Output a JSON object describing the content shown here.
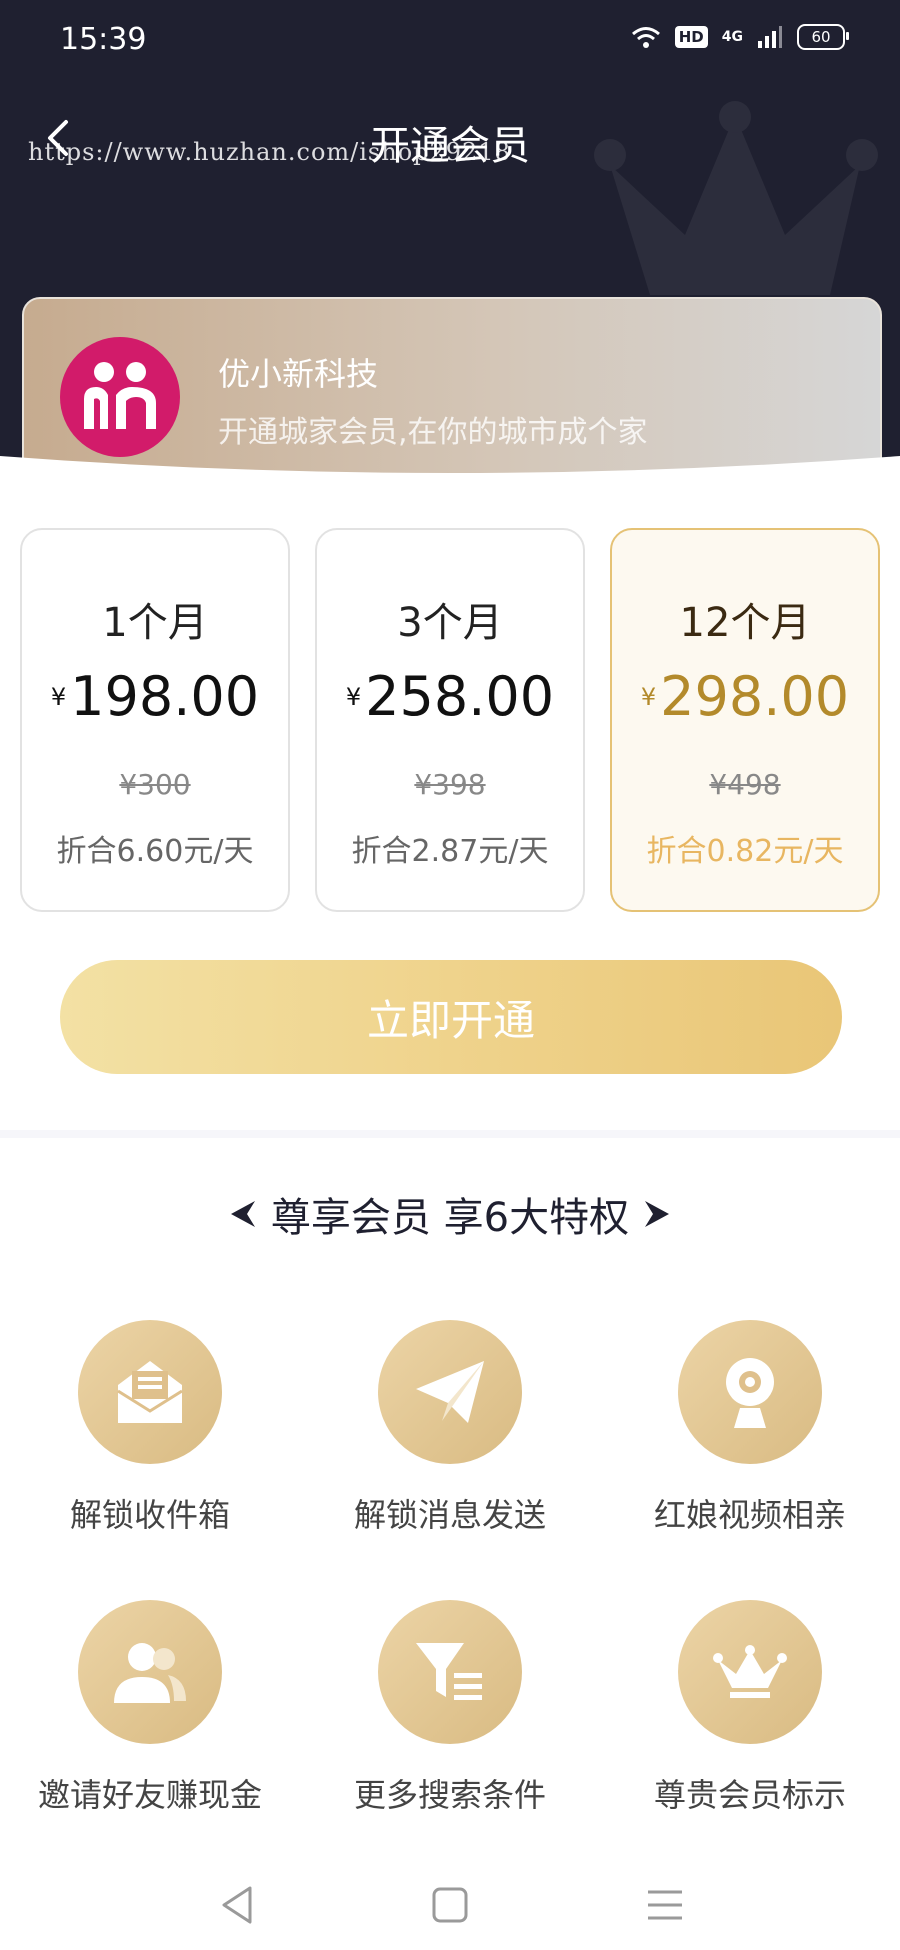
{
  "status_bar": {
    "time": "15:39",
    "hd_label": "HD",
    "network_label": "4G",
    "battery": "60"
  },
  "header": {
    "title": "开通会员",
    "watermark": "https://www.huzhan.com/ishop29218"
  },
  "brand": {
    "name": "优小新科技",
    "slogan": "开通城家会员,在你的城市成个家"
  },
  "plans": [
    {
      "duration": "1个月",
      "currency": "¥",
      "price": "198.00",
      "original": "¥300",
      "daily": "折合6.60元/天",
      "selected": false
    },
    {
      "duration": "3个月",
      "currency": "¥",
      "price": "258.00",
      "original": "¥398",
      "daily": "折合2.87元/天",
      "selected": false
    },
    {
      "duration": "12个月",
      "currency": "¥",
      "price": "298.00",
      "original": "¥498",
      "daily": "折合0.82元/天",
      "selected": true
    }
  ],
  "cta_label": "立即开通",
  "perks_title": "尊享会员 享6大特权",
  "perks": [
    {
      "label": "解锁收件箱",
      "icon": "inbox-icon"
    },
    {
      "label": "解锁消息发送",
      "icon": "paper-plane-icon"
    },
    {
      "label": "红娘视频相亲",
      "icon": "webcam-icon"
    },
    {
      "label": "邀请好友赚现金",
      "icon": "users-icon"
    },
    {
      "label": "更多搜索条件",
      "icon": "filter-icon"
    },
    {
      "label": "尊贵会员标示",
      "icon": "crown-icon"
    }
  ],
  "colors": {
    "header_bg": "#1f2030",
    "gold": "#e8b661",
    "gold_dark": "#b38a2b",
    "brand_logo": "#d21b6a"
  }
}
